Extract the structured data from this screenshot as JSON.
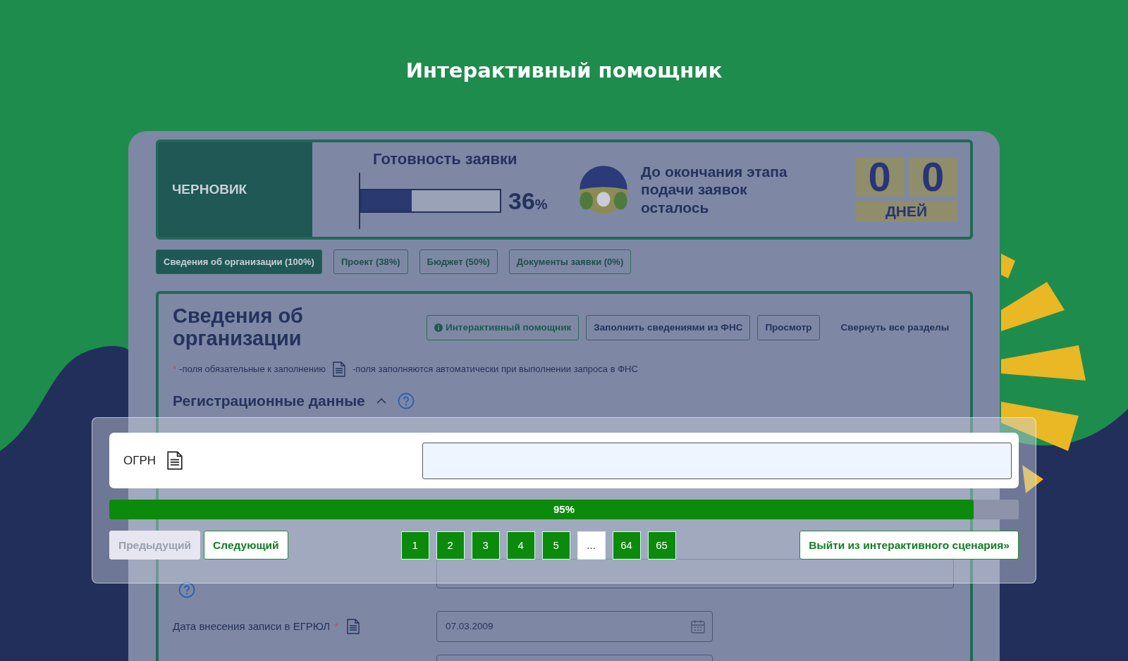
{
  "banner": {
    "title": "Интерактивный помощник"
  },
  "header": {
    "status": "ЧЕРНОВИК",
    "readiness_title": "Готовность заявки",
    "readiness": {
      "level": 0.36,
      "value": "36",
      "unit": "%"
    },
    "deadline_text": "До окончания этапа подачи заявок осталось",
    "digits": [
      "0",
      "0"
    ],
    "digits_label": "ДНЕЙ"
  },
  "tabs": [
    {
      "label": "Сведения об организации (100%)",
      "selected": true
    },
    {
      "label": "Проект (38%)",
      "selected": false
    },
    {
      "label": "Бюджет (50%)",
      "selected": false
    },
    {
      "label": "Документы заявки (0%)",
      "selected": false
    }
  ],
  "section": {
    "title": "Сведения об организации",
    "buttons": [
      {
        "label": "Интерактивный помощник",
        "kind": "info"
      },
      {
        "label": "Заполнить сведениями из ФНС",
        "kind": "outline"
      },
      {
        "label": "Просмотр",
        "kind": "outline"
      },
      {
        "label": "Свернуть все разделы",
        "kind": "link"
      }
    ],
    "legend": {
      "required_mark": "*",
      "required_text": "-поля обязательные к заполнению",
      "auto_text": "-поля заполняются автоматически при выполнении запроса в ФНС"
    },
    "subsection": "Регистрационные данные",
    "fields": [
      {
        "label": "Дата внесения записи в ЕГРЮЛ",
        "required": true,
        "auto": true,
        "value": "07.03.2009"
      }
    ]
  },
  "assistant": {
    "field": {
      "label": "ОГРН",
      "auto": true
    },
    "progress": {
      "level": 0.95,
      "label": "95%"
    },
    "prev": {
      "label": "Предыдущий",
      "disabled": true
    },
    "next": {
      "label": "Следующий",
      "disabled": false
    },
    "pages": [
      {
        "label": "1",
        "kind": "page"
      },
      {
        "label": "2",
        "kind": "page"
      },
      {
        "label": "3",
        "kind": "page"
      },
      {
        "label": "4",
        "kind": "page"
      },
      {
        "label": "5",
        "kind": "page"
      },
      {
        "label": "...",
        "kind": "ellipsis"
      },
      {
        "label": "64",
        "kind": "page"
      },
      {
        "label": "65",
        "kind": "page"
      }
    ],
    "exit": "Выйти из интерактивного сценария»"
  }
}
